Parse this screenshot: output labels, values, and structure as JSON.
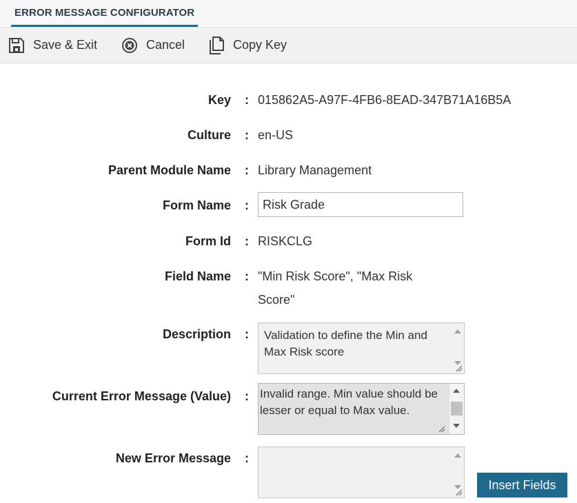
{
  "tab": {
    "title": "ERROR MESSAGE CONFIGURATOR"
  },
  "toolbar": {
    "save_label": "Save & Exit",
    "cancel_label": "Cancel",
    "copy_label": "Copy Key"
  },
  "form": {
    "separator": ":",
    "key": {
      "label": "Key",
      "value": "015862A5-A97F-4FB6-8EAD-347B71A16B5A"
    },
    "culture": {
      "label": "Culture",
      "value": "en-US"
    },
    "parent_module": {
      "label": "Parent Module Name",
      "value": "Library Management"
    },
    "form_name": {
      "label": "Form Name",
      "value": "Risk Grade"
    },
    "form_id": {
      "label": "Form Id",
      "value": "RISKCLG"
    },
    "field_name": {
      "label": "Field Name",
      "value": "\"Min Risk Score\", \"Max Risk Score\""
    },
    "description": {
      "label": "Description",
      "value": "Validation to define the Min and Max Risk score"
    },
    "current_error": {
      "label": "Current Error Message (Value)",
      "value": "Invalid range. Min value should be lesser or equal to Max value."
    },
    "new_error": {
      "label": "New Error Message",
      "value": ""
    }
  },
  "insert_fields_label": "Insert Fields",
  "colors": {
    "accent": "#1f6a8c",
    "tab_text": "#2d3e50"
  }
}
